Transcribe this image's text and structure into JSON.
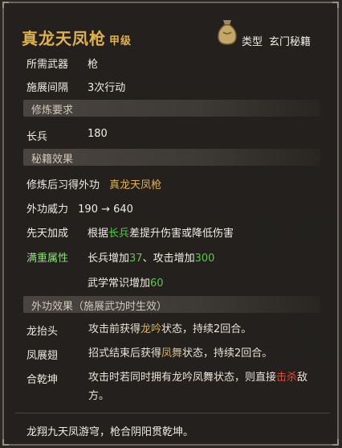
{
  "item": {
    "name": "真龙天凤枪",
    "grade": "甲级",
    "type_label": "类型",
    "type_value": "玄门秘籍"
  },
  "info": {
    "weapon_label": "所需武器",
    "weapon_value": "枪",
    "interval_label": "施展间隔",
    "interval_value": "3次行动"
  },
  "requirements": {
    "header": "修炼要求",
    "stat_label": "长兵",
    "stat_value": "180"
  },
  "effects": {
    "header": "秘籍效果",
    "learn_label": "修炼后习得外功",
    "learn_value": "真龙天凤枪",
    "power_label": "外功威力",
    "power_value": "190 → 640",
    "innate_label": "先天加成",
    "innate_prefix": "根据",
    "innate_stat": "长兵",
    "innate_suffix": "差提升伤害或降低伤害",
    "full_label": "满重属性",
    "full_line1_a": "长兵增加",
    "full_line1_b": "37",
    "full_line1_c": "、攻击增加",
    "full_line1_d": "300",
    "full_line2_a": "武学常识增加",
    "full_line2_b": "60"
  },
  "external": {
    "header": "外功效果（施展武功时生效）",
    "skills": [
      {
        "name": "龙抬头",
        "text_a": "攻击前获得",
        "text_hl": "龙吟",
        "text_b": "状态，持续2回合。"
      },
      {
        "name": "凤展翅",
        "text_a": "招式结束后获得",
        "text_hl": "凤舞",
        "text_b": "状态，持续2回合。"
      },
      {
        "name": "合乾坤",
        "text_a": "攻击时若同时拥有龙吟凤舞状态，则直接",
        "text_hl": "击杀",
        "text_b": "敌方。"
      }
    ]
  },
  "flavor": "龙翔九天凤游穹，枪合阴阳贯乾坤。",
  "colors": {
    "gold": "#e0b24c",
    "green": "#5ac84b",
    "red": "#e04a3a"
  }
}
